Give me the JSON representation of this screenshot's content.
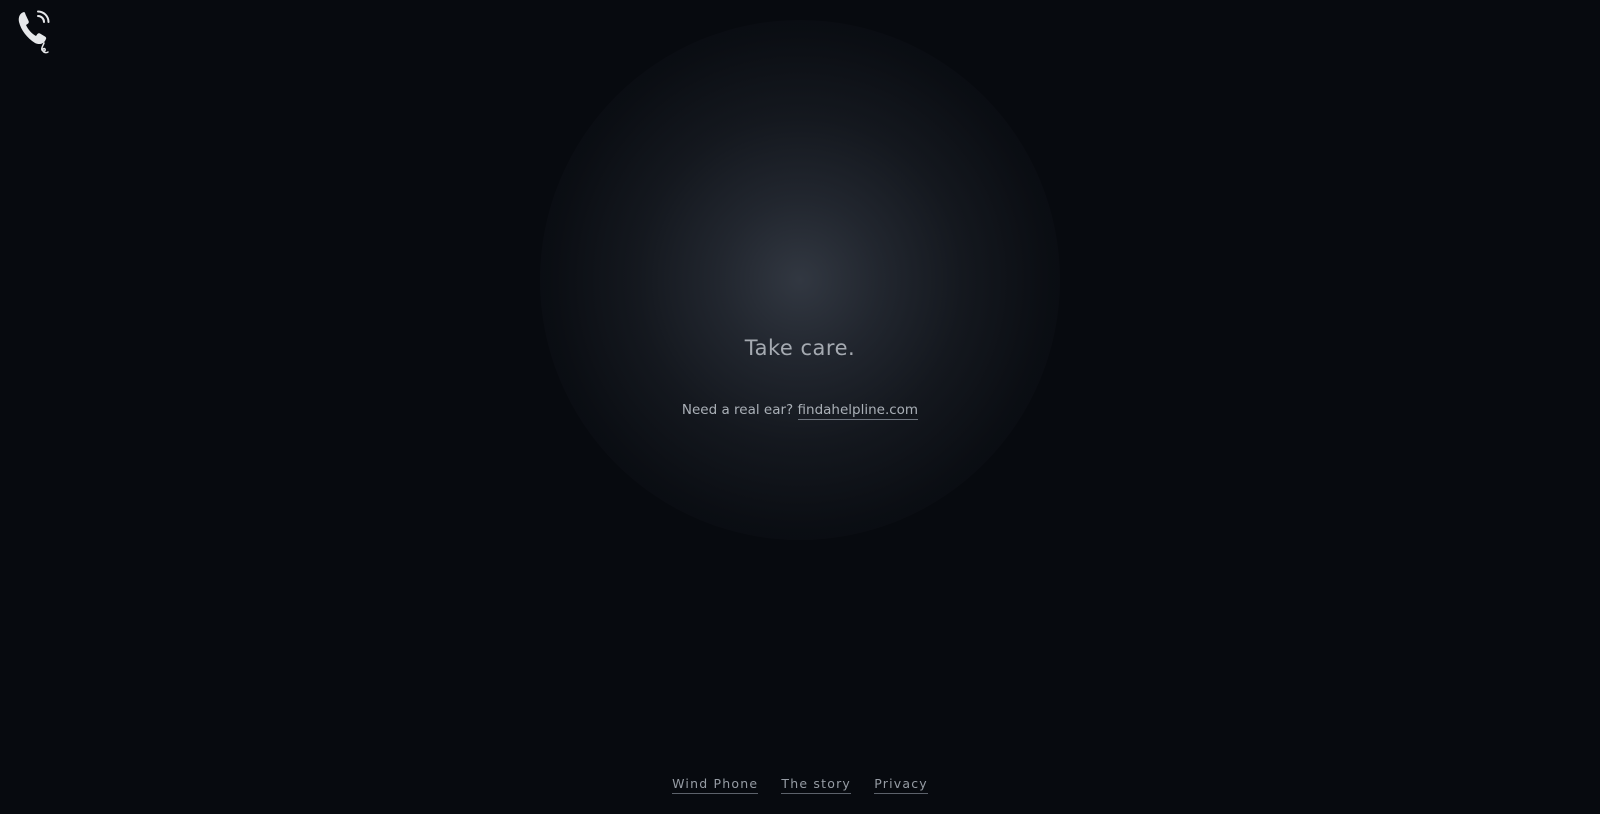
{
  "logo": {
    "icon": "phone-wind-icon",
    "color": "#e6e8ea"
  },
  "main": {
    "headline": "Take care.",
    "prompt": "Need a real ear?",
    "helpline_link": "findahelpline.com"
  },
  "footer": {
    "links": [
      {
        "label": "Wind Phone"
      },
      {
        "label": "The story"
      },
      {
        "label": "Privacy"
      }
    ]
  },
  "colors": {
    "background": "#070a0f",
    "text": "#a5aab1"
  }
}
